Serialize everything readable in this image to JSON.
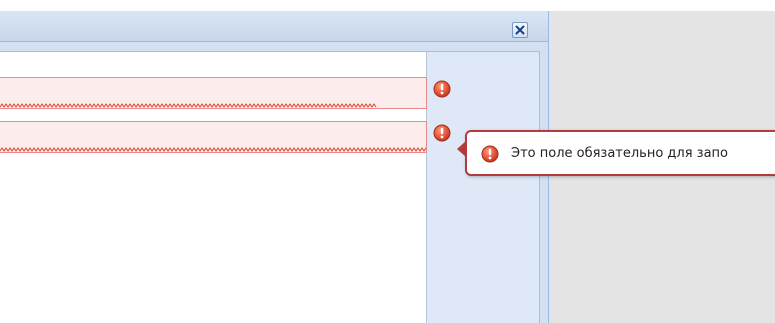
{
  "window": {
    "close_icon": "close-icon"
  },
  "form": {
    "fields": [
      {
        "value": "",
        "invalid": true
      },
      {
        "value": "",
        "invalid": true
      }
    ],
    "error_icon": "exclamation-circle-icon"
  },
  "tooltip": {
    "message": "Это поле обязательно для запо"
  },
  "colors": {
    "error_red": "#d9432f",
    "invalid_field_bg": "#fdecec",
    "invalid_field_border": "#e58b8b",
    "window_frame": "#d3e0f1"
  }
}
